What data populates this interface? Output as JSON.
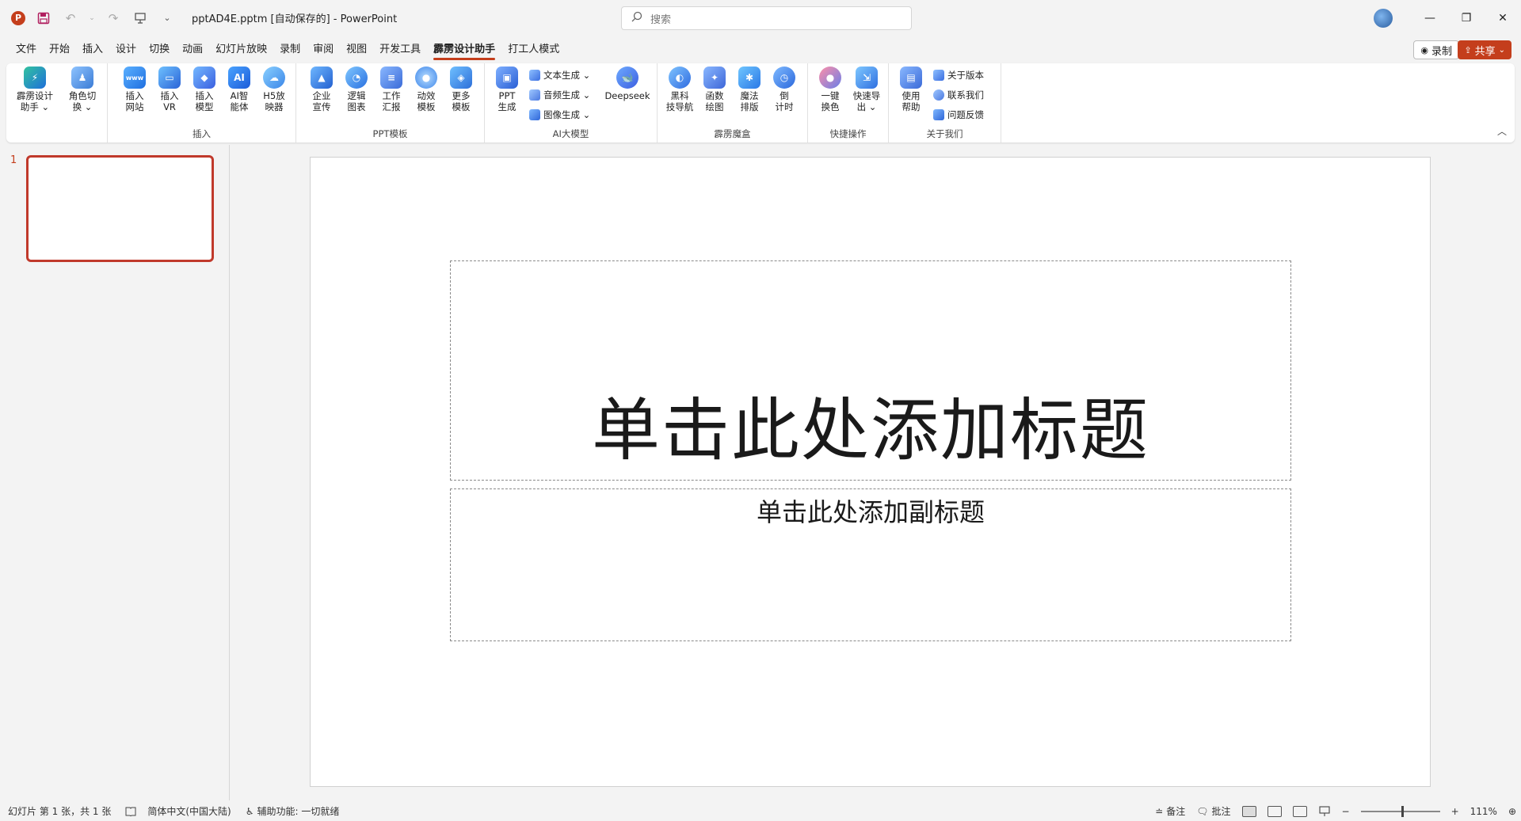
{
  "titlebar": {
    "app_icon_letter": "P",
    "doc_title": "pptAD4E.pptm [自动保存的]  -  PowerPoint",
    "search_placeholder": "搜索",
    "minimize_glyph": "—",
    "maximize_glyph": "❐",
    "close_glyph": "✕"
  },
  "menu": {
    "tabs": [
      "文件",
      "开始",
      "插入",
      "设计",
      "切换",
      "动画",
      "幻灯片放映",
      "录制",
      "审阅",
      "视图",
      "开发工具",
      "霹雳设计助手",
      "打工人模式"
    ],
    "active_tab": "霹雳设计助手",
    "record_label": "录制",
    "share_label": "共享"
  },
  "ribbon": {
    "groups": {
      "g0": {
        "label": ""
      },
      "insert": {
        "label": "插入"
      },
      "ppt_template": {
        "label": "PPT模板"
      },
      "ai_model": {
        "label": "AI大模型"
      },
      "magic_box": {
        "label": "霹雳魔盒"
      },
      "quick_ops": {
        "label": "快捷操作"
      },
      "about": {
        "label": "关于我们"
      }
    },
    "buttons": {
      "assistant": "霹雳设计\n助手 ⌄",
      "role_switch": "角色切\n换 ⌄",
      "insert_site": "插入\n网站",
      "insert_vr": "插入\nVR",
      "insert_model": "插入\n模型",
      "ai_agent": "AI智\n能体",
      "h5_player": "H5放\n映器",
      "corp_promo": "企业\n宣传",
      "logic_chart": "逻辑\n图表",
      "work_report": "工作\n汇报",
      "anim_template": "动效\n模板",
      "more_templates": "更多\n模板",
      "ppt_gen": "PPT\n生成",
      "text_gen": "文本生成 ⌄",
      "audio_gen": "音频生成 ⌄",
      "image_gen": "图像生成 ⌄",
      "deepseek": "Deepseek",
      "black_tech": "黑科\n技导航",
      "func_plot": "函数\n绘图",
      "magic_layout": "魔法\n排版",
      "countdown": "倒\n计时",
      "one_key_color": "一键\n换色",
      "quick_export": "快速导\n出 ⌄",
      "help": "使用\n帮助",
      "about_version": "关于版本",
      "contact_us": "联系我们",
      "feedback": "问题反馈"
    },
    "icons": {
      "ai_agent_text": "AI",
      "insert_site_text": "www"
    }
  },
  "thumbnails": {
    "slide_number": "1"
  },
  "slide": {
    "title_placeholder": "单击此处添加标题",
    "subtitle_placeholder": "单击此处添加副标题"
  },
  "statusbar": {
    "slide_info": "幻灯片 第 1 张，共 1 张",
    "language": "简体中文(中国大陆)",
    "accessibility": "辅助功能: 一切就绪",
    "notes": "备注",
    "comments": "批注",
    "zoom_minus": "−",
    "zoom_plus": "+",
    "zoom_level": "111%"
  },
  "colors": {
    "accent": "#c43e1c",
    "selected_thumb_border": "#c0392b",
    "save_icon": "#b11f5f"
  }
}
